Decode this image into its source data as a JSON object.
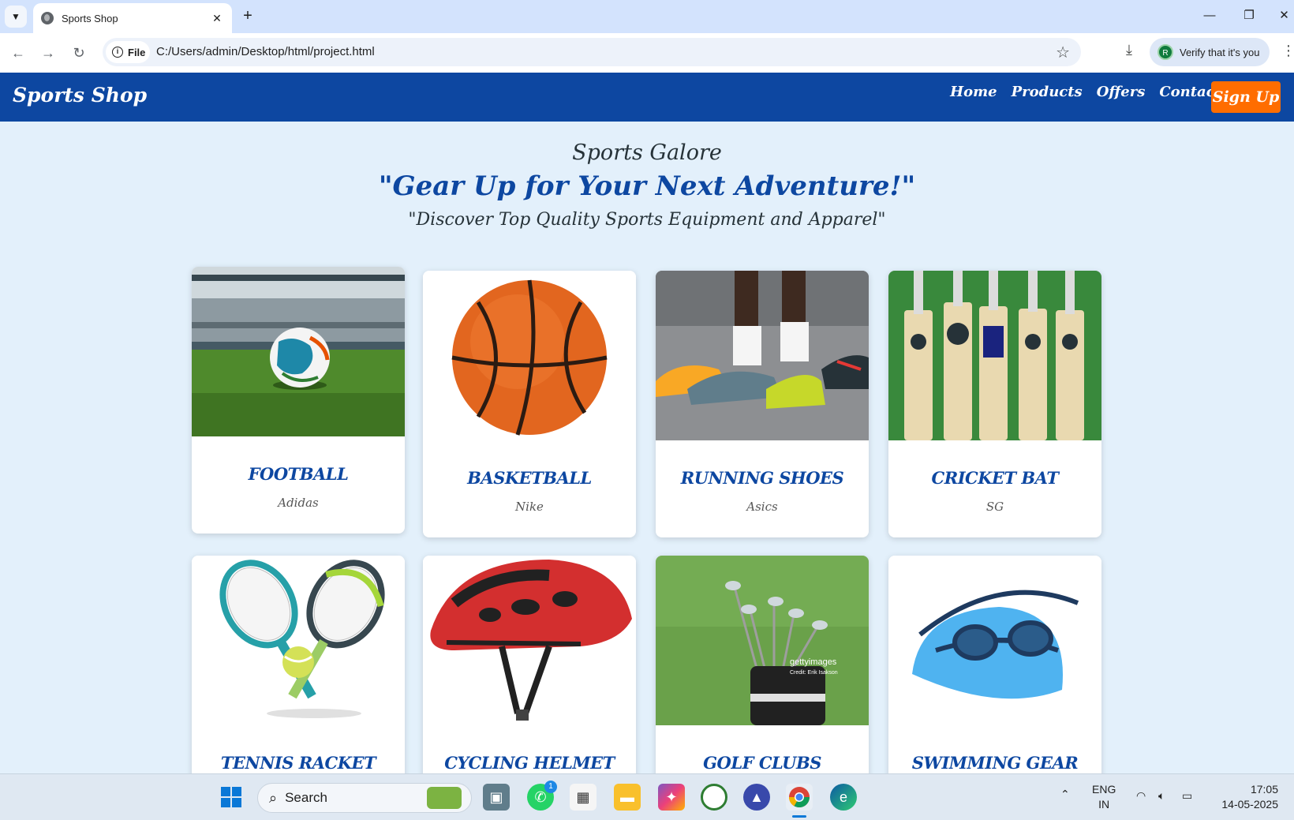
{
  "browser": {
    "tab_title": "Sports Shop",
    "url": "C:/Users/admin/Desktop/html/project.html",
    "file_chip": "File",
    "verify_label": "Verify that it's you",
    "avatar_letter": "R"
  },
  "site": {
    "logo": "Sports Shop",
    "nav": [
      "Home",
      "Products",
      "Offers",
      "Contact"
    ],
    "signup": "Sign Up"
  },
  "hero": {
    "title": "Sports Galore",
    "tagline": "\"Gear Up for Your Next Adventure!\"",
    "subtitle": "\"Discover Top Quality Sports Equipment and Apparel\""
  },
  "products": [
    {
      "name": "FOOTBALL",
      "brand": "Adidas"
    },
    {
      "name": "BASKETBALL",
      "brand": "Nike"
    },
    {
      "name": "RUNNING SHOES",
      "brand": "Asics"
    },
    {
      "name": "CRICKET BAT",
      "brand": "SG"
    },
    {
      "name": "TENNIS RACKET",
      "brand": ""
    },
    {
      "name": "CYCLING HELMET",
      "brand": ""
    },
    {
      "name": "GOLF CLUBS",
      "brand": ""
    },
    {
      "name": "SWIMMING GEAR",
      "brand": ""
    }
  ],
  "image_text": {
    "golf_watermark": "gettyimages",
    "golf_credit": "Credit: Erik Isakson"
  },
  "taskbar": {
    "search_label": "Search",
    "whatsapp_badge": "1",
    "lang_top": "ENG",
    "lang_bottom": "IN",
    "time": "17:05",
    "date": "14-05-2025"
  },
  "colors": {
    "brand_blue": "#0d47a1",
    "accent_orange": "#ff6d00",
    "page_bg": "#e3f0fb"
  }
}
